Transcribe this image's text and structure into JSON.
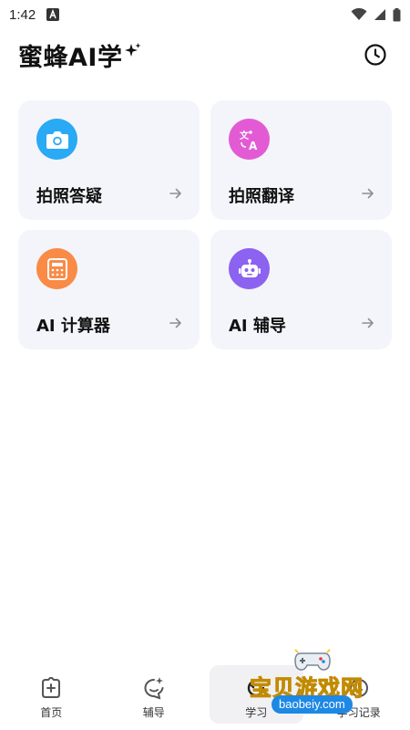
{
  "status": {
    "time": "1:42"
  },
  "header": {
    "title": "蜜蜂AI学"
  },
  "cards": [
    {
      "label": "拍照答疑",
      "icon": "camera-icon",
      "color": "#2aa9f4"
    },
    {
      "label": "拍照翻译",
      "icon": "translate-icon",
      "color": "#e35bd4"
    },
    {
      "label": "AI 计算器",
      "icon": "calculator-icon",
      "color": "#f98b46"
    },
    {
      "label": "AI 辅导",
      "icon": "robot-icon",
      "color": "#8c62f0"
    }
  ],
  "nav": [
    {
      "label": "首页",
      "icon": "home-plus-icon"
    },
    {
      "label": "辅导",
      "icon": "chat-sparkle-icon"
    },
    {
      "label": "学习",
      "icon": "study-icon",
      "active": true
    },
    {
      "label": "学习记录",
      "icon": "history-icon"
    }
  ],
  "watermark": {
    "text": "宝贝游戏网",
    "url": "baobeiy.com"
  },
  "colors": {
    "card_bg": "#f4f5fa",
    "nav_active_bg": "#f1f1f3"
  }
}
